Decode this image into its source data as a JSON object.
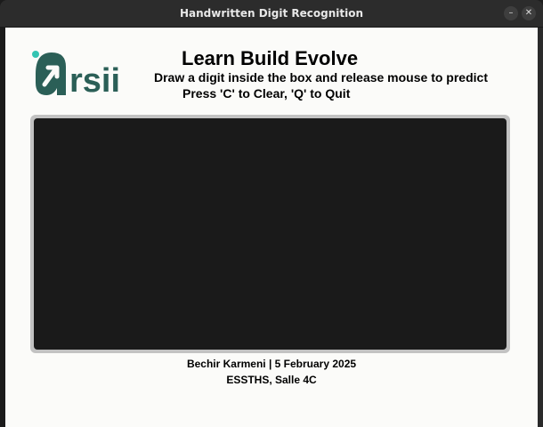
{
  "window": {
    "title": "Handwritten Digit Recognition",
    "minimize_glyph": "–",
    "close_glyph": "✕"
  },
  "logo": {
    "text": "rsii",
    "icon": "arsii-logo-icon",
    "color": "#2b5f57",
    "accent": "#33c4b2"
  },
  "header": {
    "headline": "Learn Build Evolve",
    "instruction_draw": "Draw a digit inside the box and release mouse to predict",
    "instruction_keys": "Press 'C' to Clear, 'Q' to Quit"
  },
  "canvas": {
    "background": "#1a1a1a",
    "frame": "#c2c2c2"
  },
  "footer": {
    "author_date": "Bechir Karmeni | 5 February 2025",
    "location": "ESSTHS, Salle 4C"
  }
}
